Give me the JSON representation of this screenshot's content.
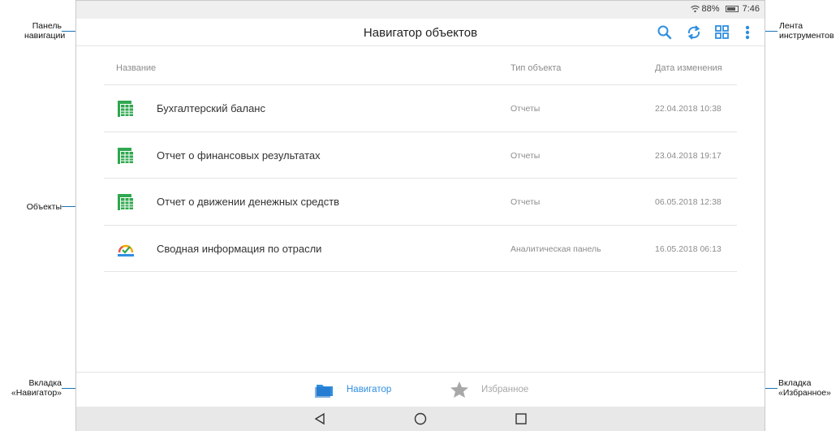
{
  "statusbar": {
    "battery_text": "88%",
    "time": "7:46"
  },
  "appbar": {
    "title": "Навигатор объектов",
    "tools": [
      "search-icon",
      "refresh-icon",
      "grid-view-icon",
      "more-icon"
    ]
  },
  "table": {
    "columns": [
      "Название",
      "Тип объекта",
      "Дата изменения"
    ],
    "rows": [
      {
        "icon": "spreadsheet-icon",
        "name": "Бухгалтерский баланс",
        "type": "Отчеты",
        "date": "22.04.2018 10:38"
      },
      {
        "icon": "spreadsheet-icon",
        "name": "Отчет о финансовых результатах",
        "type": "Отчеты",
        "date": "23.04.2018 19:17"
      },
      {
        "icon": "spreadsheet-icon",
        "name": "Отчет о движении денежных средств",
        "type": "Отчеты",
        "date": "06.05.2018 12:38"
      },
      {
        "icon": "dashboard-icon",
        "name": "Сводная информация по отрасли",
        "type": "Аналитическая панель",
        "date": "16.05.2018 06:13"
      }
    ]
  },
  "tabs": [
    {
      "label": "Навигатор",
      "icon": "folder-icon",
      "active": true
    },
    {
      "label": "Избранное",
      "icon": "star-icon",
      "active": false
    }
  ],
  "callouts": {
    "nav_panel": [
      "Панель",
      "навигации"
    ],
    "toolbar": [
      "Лента",
      "инструментов"
    ],
    "objects": "Объекты",
    "tab_navigator": [
      "Вкладка",
      "«Навигатор»"
    ],
    "tab_favorites": [
      "Вкладка",
      "«Избранное»"
    ]
  },
  "colors": {
    "accent": "#2f8fe0",
    "callout": "#1a73b5",
    "green": "#2fa84f",
    "inactive": "#a8a8a8"
  }
}
